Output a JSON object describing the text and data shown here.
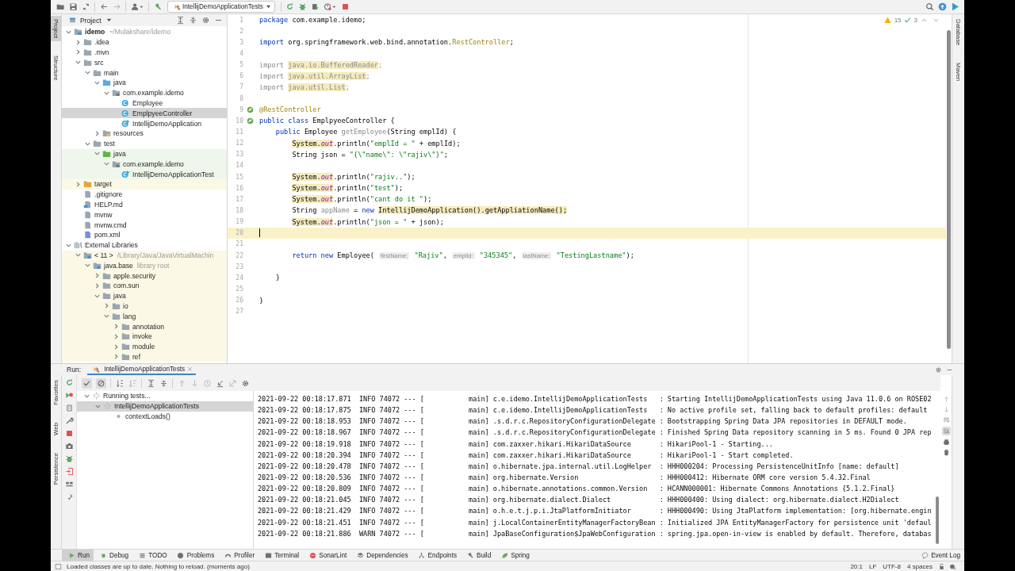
{
  "toolbar": {
    "run_config": "IntellijDemoApplicationTests"
  },
  "left_stripe": [
    {
      "label": "Project",
      "selected": true
    },
    {
      "label": "Structure",
      "selected": false
    }
  ],
  "project": {
    "title": "Project",
    "tree": [
      {
        "label": "idemo",
        "kind": "module",
        "note": "~/Mulakshare/idemo",
        "expanded": true,
        "selected": false,
        "children": [
          {
            "label": ".idea",
            "kind": "folder",
            "expanded": false,
            "selected": false
          },
          {
            "label": ".mvn",
            "kind": "folder",
            "expanded": false,
            "selected": false
          },
          {
            "label": "src",
            "kind": "folder",
            "expanded": true,
            "selected": false,
            "children": [
              {
                "label": "main",
                "kind": "folder",
                "expanded": true,
                "selected": false,
                "children": [
                  {
                    "label": "java",
                    "kind": "folder-src",
                    "expanded": true,
                    "selected": false,
                    "children": [
                      {
                        "label": "com.example.idemo",
                        "kind": "package",
                        "expanded": true,
                        "selected": false,
                        "children": [
                          {
                            "label": "Employee",
                            "kind": "class",
                            "selected": false
                          },
                          {
                            "label": "EmplpyeeController",
                            "kind": "class",
                            "selected": true
                          },
                          {
                            "label": "IntellijDemoApplication",
                            "kind": "class-run",
                            "selected": false
                          }
                        ]
                      }
                    ]
                  },
                  {
                    "label": "resources",
                    "kind": "folder-res",
                    "expanded": false,
                    "selected": false
                  }
                ]
              },
              {
                "label": "test",
                "kind": "folder",
                "expanded": true,
                "selected": false,
                "children": [
                  {
                    "label": "java",
                    "kind": "folder-test",
                    "expanded": true,
                    "selected": false,
                    "color": "#eff7ec",
                    "children": [
                      {
                        "label": "com.example.idemo",
                        "kind": "package",
                        "expanded": true,
                        "selected": false,
                        "color": "#eff7ec",
                        "children": [
                          {
                            "label": "IntellijDemoApplicationTest",
                            "kind": "class-run",
                            "selected": false,
                            "color": "#eff7ec"
                          }
                        ]
                      }
                    ]
                  }
                ]
              }
            ]
          },
          {
            "label": "target",
            "kind": "folder-excluded",
            "expanded": false,
            "selected": false,
            "color": "#fbf9e6"
          },
          {
            "label": ".gitignore",
            "kind": "file",
            "selected": false
          },
          {
            "label": "HELP.md",
            "kind": "file-md",
            "selected": false
          },
          {
            "label": "mvnw",
            "kind": "file",
            "selected": false
          },
          {
            "label": "mvnw.cmd",
            "kind": "file",
            "selected": false
          },
          {
            "label": "pom.xml",
            "kind": "file-maven",
            "selected": false
          }
        ]
      },
      {
        "label": "External Libraries",
        "kind": "library",
        "expanded": true,
        "selected": false,
        "children": [
          {
            "label": "< 11 >",
            "kind": "jdk",
            "note": "/Library/Java/JavaVirtualMachin",
            "expanded": true,
            "selected": false,
            "color": "#fbf9e6",
            "children": [
              {
                "label": "java.base",
                "kind": "jar",
                "note": "library root",
                "expanded": true,
                "selected": false,
                "color": "#fbf9e6",
                "children": [
                  {
                    "label": "apple.security",
                    "kind": "folder",
                    "expanded": false,
                    "selected": false,
                    "color": "#fbf9e6"
                  },
                  {
                    "label": "com.sun",
                    "kind": "folder",
                    "expanded": false,
                    "selected": false,
                    "color": "#fbf9e6"
                  },
                  {
                    "label": "java",
                    "kind": "folder",
                    "expanded": true,
                    "selected": false,
                    "color": "#fbf9e6",
                    "children": [
                      {
                        "label": "io",
                        "kind": "folder",
                        "expanded": false,
                        "selected": false,
                        "color": "#fbf9e6"
                      },
                      {
                        "label": "lang",
                        "kind": "folder",
                        "expanded": true,
                        "selected": false,
                        "color": "#fbf9e6",
                        "children": [
                          {
                            "label": "annotation",
                            "kind": "folder",
                            "expanded": false,
                            "selected": false,
                            "color": "#fbf9e6"
                          },
                          {
                            "label": "invoke",
                            "kind": "folder",
                            "expanded": false,
                            "selected": false,
                            "color": "#fbf9e6"
                          },
                          {
                            "label": "module",
                            "kind": "folder",
                            "expanded": false,
                            "selected": false,
                            "color": "#fbf9e6"
                          },
                          {
                            "label": "ref",
                            "kind": "folder",
                            "expanded": false,
                            "selected": false,
                            "color": "#fbf9e6"
                          }
                        ]
                      }
                    ]
                  }
                ]
              }
            ]
          }
        ]
      }
    ]
  },
  "editor": {
    "warnings": "15",
    "checks": "3",
    "lines": [
      {
        "n": "1",
        "current": false,
        "tokens": [
          {
            "text": "package",
            "kind": "kw"
          },
          {
            "text": " com.example.idemo;",
            "kind": "plain"
          }
        ]
      },
      {
        "n": "2",
        "current": false
      },
      {
        "n": "3",
        "current": false,
        "tokens": [
          {
            "text": "import",
            "kind": "kw"
          },
          {
            "text": " org.springframework.web.bind.annotation.",
            "kind": "plain"
          },
          {
            "text": "RestController",
            "kind": "ann"
          },
          {
            "text": ";",
            "kind": "plain"
          }
        ]
      },
      {
        "n": "4",
        "current": false
      },
      {
        "n": "5",
        "current": false,
        "tokens": [
          {
            "text": "import ",
            "kind": "dim"
          },
          {
            "text": "java.io.BufferedReader",
            "kind": "warn-dim"
          },
          {
            "text": ";",
            "kind": "dim"
          }
        ]
      },
      {
        "n": "6",
        "current": false,
        "tokens": [
          {
            "text": "import ",
            "kind": "dim"
          },
          {
            "text": "java.util.ArrayList",
            "kind": "warn-dim"
          },
          {
            "text": ";",
            "kind": "dim"
          }
        ]
      },
      {
        "n": "7",
        "current": false,
        "tokens": [
          {
            "text": "import ",
            "kind": "dim"
          },
          {
            "text": "java.util.List",
            "kind": "warn-dim"
          },
          {
            "text": ";",
            "kind": "dim"
          }
        ]
      },
      {
        "n": "8",
        "current": false
      },
      {
        "n": "9",
        "current": false,
        "kind": "bean",
        "tokens": [
          {
            "text": "@RestController",
            "kind": "ann"
          }
        ]
      },
      {
        "n": "10",
        "current": false,
        "kind": "bean",
        "tokens": [
          {
            "text": "public class",
            "kind": "kw"
          },
          {
            "text": " EmplpyeeController {",
            "kind": "plain"
          }
        ]
      },
      {
        "n": "11",
        "current": false,
        "tokens": [
          {
            "text": "    public",
            "kind": "kw"
          },
          {
            "text": " Employee ",
            "kind": "plain"
          },
          {
            "text": "getEmployee",
            "kind": "dim"
          },
          {
            "text": "(String emplId) {",
            "kind": "plain"
          }
        ]
      },
      {
        "n": "12",
        "current": false,
        "tokens": [
          {
            "text": "        System.",
            "kind": "warn"
          },
          {
            "text": "out",
            "kind": "warn-field"
          },
          {
            "text": ".println(",
            "kind": "plain"
          },
          {
            "text": "\"emplId = \"",
            "kind": "str"
          },
          {
            "text": " + emplId);",
            "kind": "plain"
          }
        ]
      },
      {
        "n": "13",
        "current": false,
        "tokens": [
          {
            "text": "        String json = ",
            "kind": "plain"
          },
          {
            "text": "\"{\\\"name\\\": \\\"rajiv\\\"}\"",
            "kind": "str"
          },
          {
            "text": ";",
            "kind": "plain"
          }
        ]
      },
      {
        "n": "14",
        "current": false
      },
      {
        "n": "15",
        "current": false,
        "tokens": [
          {
            "text": "        System.",
            "kind": "warn"
          },
          {
            "text": "out",
            "kind": "warn-field"
          },
          {
            "text": ".println(",
            "kind": "plain"
          },
          {
            "text": "\"rajiv..\"",
            "kind": "str"
          },
          {
            "text": ");",
            "kind": "plain"
          }
        ]
      },
      {
        "n": "16",
        "current": false,
        "tokens": [
          {
            "text": "        System.",
            "kind": "warn"
          },
          {
            "text": "out",
            "kind": "warn-field"
          },
          {
            "text": ".println(",
            "kind": "plain"
          },
          {
            "text": "\"test\"",
            "kind": "str"
          },
          {
            "text": ");",
            "kind": "plain"
          }
        ]
      },
      {
        "n": "17",
        "current": false,
        "tokens": [
          {
            "text": "        System.",
            "kind": "warn"
          },
          {
            "text": "out",
            "kind": "warn-field"
          },
          {
            "text": ".println(",
            "kind": "plain"
          },
          {
            "text": "\"cant do it \"",
            "kind": "str"
          },
          {
            "text": ");",
            "kind": "plain"
          }
        ]
      },
      {
        "n": "18",
        "current": false,
        "tokens": [
          {
            "text": "        String ",
            "kind": "plain"
          },
          {
            "text": "appName",
            "kind": "dim"
          },
          {
            "text": " = ",
            "kind": "plain"
          },
          {
            "text": "new",
            "kind": "kw"
          },
          {
            "text": " IntellijDemoApplication().getAppliationName();",
            "kind": "warn"
          }
        ]
      },
      {
        "n": "19",
        "current": false,
        "tokens": [
          {
            "text": "        System.",
            "kind": "warn"
          },
          {
            "text": "out",
            "kind": "warn-field"
          },
          {
            "text": ".println(",
            "kind": "plain"
          },
          {
            "text": "\"json = \"",
            "kind": "str"
          },
          {
            "text": " + json);",
            "kind": "plain"
          }
        ]
      },
      {
        "n": "20",
        "current": true
      },
      {
        "n": "21",
        "current": false
      },
      {
        "n": "22",
        "current": false,
        "tokens": [
          {
            "text": "        return new",
            "kind": "kw"
          },
          {
            "text": " Employee( ",
            "kind": "plain"
          },
          {
            "text": "firstName:",
            "kind": "hint"
          },
          {
            "text": " \"Rajiv\"",
            "kind": "str"
          },
          {
            "text": ", ",
            "kind": "plain"
          },
          {
            "text": "emplId:",
            "kind": "hint"
          },
          {
            "text": " \"345345\"",
            "kind": "str"
          },
          {
            "text": ", ",
            "kind": "plain"
          },
          {
            "text": "lastName:",
            "kind": "hint"
          },
          {
            "text": " \"TestingLastname\"",
            "kind": "str"
          },
          {
            "text": ");",
            "kind": "plain"
          }
        ]
      },
      {
        "n": "23",
        "current": false
      },
      {
        "n": "24",
        "current": false,
        "tokens": [
          {
            "text": "    }",
            "kind": "plain"
          }
        ]
      },
      {
        "n": "25",
        "current": false
      },
      {
        "n": "26",
        "current": false,
        "tokens": [
          {
            "text": "}",
            "kind": "plain"
          }
        ]
      },
      {
        "n": "27",
        "current": false
      }
    ]
  },
  "right_stripe": [
    "Database",
    "Maven"
  ],
  "run": {
    "label": "Run:",
    "tab": "IntellijDemoApplicationTests",
    "tree": [
      {
        "label": "Running tests...",
        "kind": "running",
        "expanded": true,
        "selected": false,
        "children": [
          {
            "label": "IntellijDemoApplicationTests",
            "kind": "running",
            "expanded": true,
            "selected": true,
            "children": [
              {
                "label": "contextLoads()",
                "kind": "pending",
                "selected": false
              }
            ]
          }
        ]
      }
    ],
    "log": [
      "2021-09-22 00:18:17.871  INFO 74072 --- [           main] c.e.idemo.IntellijDemoApplicationTests   : Starting IntellijDemoApplicationTests using Java 11.0.6 on ROSE02",
      "2021-09-22 00:18:17.875  INFO 74072 --- [           main] c.e.idemo.IntellijDemoApplicationTests   : No active profile set, falling back to default profiles: default",
      "2021-09-22 00:18:18.953  INFO 74072 --- [           main] .s.d.r.c.RepositoryConfigurationDelegate : Bootstrapping Spring Data JPA repositories in DEFAULT mode.",
      "2021-09-22 00:18:18.967  INFO 74072 --- [           main] .s.d.r.c.RepositoryConfigurationDelegate : Finished Spring Data repository scanning in 5 ms. Found 0 JPA rep",
      "2021-09-22 00:18:19.918  INFO 74072 --- [           main] com.zaxxer.hikari.HikariDataSource       : HikariPool-1 - Starting...",
      "2021-09-22 00:18:20.394  INFO 74072 --- [           main] com.zaxxer.hikari.HikariDataSource       : HikariPool-1 - Start completed.",
      "2021-09-22 00:18:20.478  INFO 74072 --- [           main] o.hibernate.jpa.internal.util.LogHelper  : HHH000204: Processing PersistenceUnitInfo [name: default]",
      "2021-09-22 00:18:20.536  INFO 74072 --- [           main] org.hibernate.Version                    : HHH000412: Hibernate ORM core version 5.4.32.Final",
      "2021-09-22 00:18:20.809  INFO 74072 --- [           main] o.hibernate.annotations.common.Version   : HCANN000001: Hibernate Commons Annotations {5.1.2.Final}",
      "2021-09-22 00:18:21.045  INFO 74072 --- [           main] org.hibernate.dialect.Dialect            : HHH000400: Using dialect: org.hibernate.dialect.H2Dialect",
      "2021-09-22 00:18:21.429  INFO 74072 --- [           main] o.h.e.t.j.p.i.JtaPlatformInitiator       : HHH000490: Using JtaPlatform implementation: [org.hibernate.engin",
      "2021-09-22 00:18:21.451  INFO 74072 --- [           main] j.LocalContainerEntityManagerFactoryBean : Initialized JPA EntityManagerFactory for persistence unit 'defaul",
      "2021-09-22 00:18:21.886  WARN 74072 --- [           main] JpaBaseConfiguration$JpaWebConfiguration : spring.jpa.open-in-view is enabled by default. Therefore, databas"
    ]
  },
  "run_stripe": [
    "Favorites",
    "Web",
    "Persistence"
  ],
  "tool_tabs": [
    {
      "label": "Run",
      "selected": true
    },
    {
      "label": "Debug",
      "selected": false
    },
    {
      "label": "TODO",
      "selected": false
    },
    {
      "label": "Problems",
      "selected": false
    },
    {
      "label": "Profiler",
      "selected": false
    },
    {
      "label": "Terminal",
      "selected": false
    },
    {
      "label": "SonarLint",
      "selected": false
    },
    {
      "label": "Dependencies",
      "selected": false
    },
    {
      "label": "Endpoints",
      "selected": false
    },
    {
      "label": "Build",
      "selected": false
    },
    {
      "label": "Spring",
      "selected": false
    }
  ],
  "event_log": "Event Log",
  "status": {
    "message": "Loaded classes are up to date. Nothing to reload. (moments ago)",
    "items": [
      "20:1",
      "LF",
      "UTF-8",
      "4 spaces"
    ]
  }
}
